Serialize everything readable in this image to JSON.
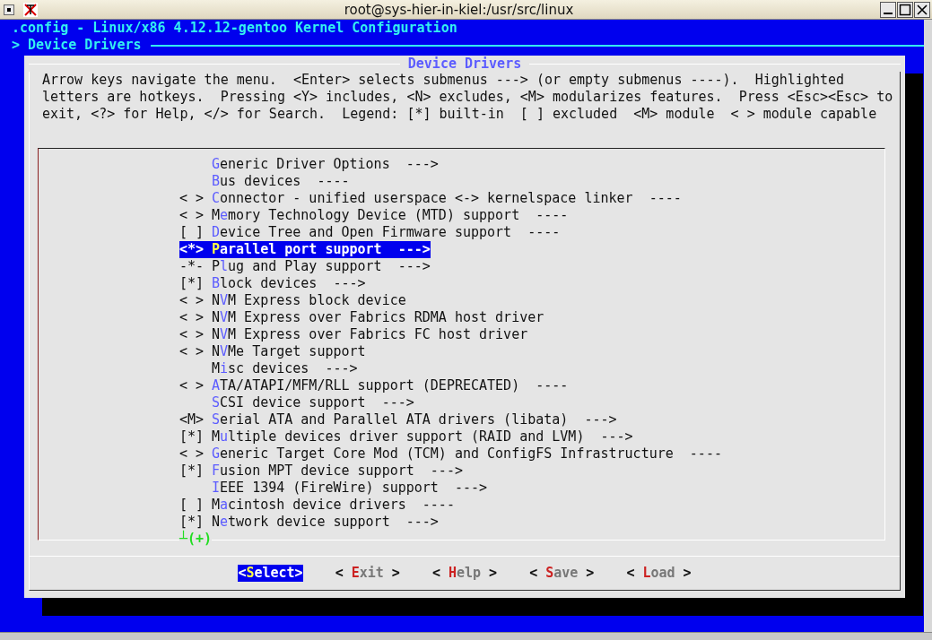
{
  "window": {
    "title": "root@sys-hier-in-kiel:/usr/src/linux"
  },
  "header": {
    "title": ".config - Linux/x86 4.12.12-gentoo Kernel Configuration",
    "breadcrumb": "> Device Drivers"
  },
  "dialog": {
    "title": "Device Drivers",
    "help_lines": [
      "Arrow keys navigate the menu.  <Enter> selects submenus ---> (or empty submenus ----).  Highlighted",
      "letters are hotkeys.  Pressing <Y> includes, <N> excludes, <M> modularizes features.  Press <Esc><Esc> to",
      "exit, <?> for Help, </> for Search.  Legend: [*] built-in  [ ] excluded  <M> module  < > module capable"
    ],
    "items": [
      {
        "hotkey": "G",
        "after": "eneric Driver Options  --->",
        "selected": false
      },
      {
        "hotkey": "B",
        "after": "us devices  ----",
        "selected": false
      },
      {
        "prefix": "< >",
        "hotkey": "C",
        "after": "onnector - unified userspace <-> kernelspace linker  ----",
        "selected": false
      },
      {
        "prefix": "< >",
        "before": "M",
        "hotkey": "e",
        "after": "mory Technology Device (MTD) support  ----",
        "selected": false
      },
      {
        "prefix": "[ ]",
        "hotkey": "D",
        "after": "evice Tree and Open Firmware support  ----",
        "selected": false
      },
      {
        "prefix": "<*>",
        "hotkey": "P",
        "after": "arallel port support  --->",
        "selected": true
      },
      {
        "prefix": "-*-",
        "before": "P",
        "hotkey": "l",
        "after": "ug and Play support  --->",
        "selected": false
      },
      {
        "prefix": "[*]",
        "hotkey": "B",
        "after": "lock devices  --->",
        "selected": false
      },
      {
        "prefix": "< >",
        "before": "N",
        "hotkey": "V",
        "after": "M Express block device",
        "selected": false
      },
      {
        "prefix": "< >",
        "before": "N",
        "hotkey": "V",
        "after": "M Express over Fabrics RDMA host driver",
        "selected": false
      },
      {
        "prefix": "< >",
        "before": "N",
        "hotkey": "V",
        "after": "M Express over Fabrics FC host driver",
        "selected": false
      },
      {
        "prefix": "< >",
        "before": "N",
        "hotkey": "V",
        "after": "Me Target support",
        "selected": false
      },
      {
        "before": "M",
        "hotkey": "i",
        "after": "sc devices  --->",
        "selected": false
      },
      {
        "prefix": "< >",
        "hotkey": "A",
        "after": "TA/ATAPI/MFM/RLL support (DEPRECATED)  ----",
        "selected": false
      },
      {
        "hotkey": "S",
        "after": "CSI device support  --->",
        "selected": false
      },
      {
        "prefix": "<M>",
        "hotkey": "S",
        "after": "erial ATA and Parallel ATA drivers (libata)  --->",
        "selected": false
      },
      {
        "prefix": "[*]",
        "before": "M",
        "hotkey": "u",
        "after": "ltiple devices driver support (RAID and LVM)  --->",
        "selected": false
      },
      {
        "prefix": "< >",
        "hotkey": "G",
        "after": "eneric Target Core Mod (TCM) and ConfigFS Infrastructure  ----",
        "selected": false
      },
      {
        "prefix": "[*]",
        "hotkey": "F",
        "after": "usion MPT device support  --->",
        "selected": false
      },
      {
        "hotkey": "I",
        "after": "EEE 1394 (FireWire) support  --->",
        "selected": false
      },
      {
        "prefix": "[ ]",
        "before": "M",
        "hotkey": "a",
        "after": "cintosh device drivers  ----",
        "selected": false
      },
      {
        "prefix": "[*]",
        "before": "N",
        "hotkey": "e",
        "after": "twork device support  --->",
        "selected": false
      }
    ],
    "more_indicator": "┴(+)",
    "buttons": [
      {
        "open": "<",
        "hotkey": "S",
        "rest": "elect",
        "close": ">",
        "selected": true
      },
      {
        "open": "< ",
        "hotkey": "E",
        "rest": "xit",
        "close": " >",
        "selected": false
      },
      {
        "open": "< ",
        "hotkey": "H",
        "rest": "elp",
        "close": " >",
        "selected": false
      },
      {
        "open": "< ",
        "hotkey": "S",
        "rest": "ave",
        "close": " >",
        "selected": false
      },
      {
        "open": "< ",
        "hotkey": "L",
        "rest": "oad",
        "close": " >",
        "selected": false
      }
    ]
  }
}
